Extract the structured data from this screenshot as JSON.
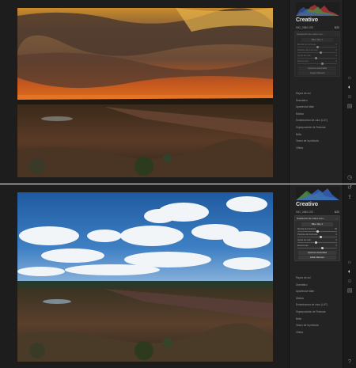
{
  "screens": [
    {
      "module_title": "Creativo",
      "filename": "IMG_0586.CR2",
      "count": "8/20",
      "module_header": "Sustitución de cielos con...",
      "preset": "Blue Sky 1",
      "sliders": [
        {
          "label": "Mezcla de horizonte",
          "value": "0",
          "level": 0.5
        },
        {
          "label": "Posición del horizonte",
          "value": "0",
          "level": 0.55
        },
        {
          "label": "Ajuste de cielo",
          "value": "0",
          "level": 0.45
        },
        {
          "label": "Escena roja",
          "value": "0",
          "level": 0.6
        }
      ],
      "buttons": [
        "Opciones avanzadas",
        "Cargar Máscara"
      ],
      "sections": [
        "Rayos de sol",
        "Dramático",
        "Apariencia Mate",
        "Místico",
        "Embelecedor de color (LUT)",
        "Superposición de Texturas",
        "Brillo",
        "Grano de la película",
        "Viñeta"
      ]
    },
    {
      "module_title": "Creativo",
      "filename": "IMG_0586.CR2",
      "count": "8/20",
      "module_header": "Sustitución de cielos com...",
      "preset": "Blue Sky 1",
      "sliders": [
        {
          "label": "Mezcla de horizonte",
          "value": "30",
          "level": 0.5
        },
        {
          "label": "Posición del horizonte",
          "value": "0",
          "level": 0.55
        },
        {
          "label": "Ajuste de cielo",
          "value": "0",
          "level": 0.45
        },
        {
          "label": "Escena roja",
          "value": "0",
          "level": 0.6
        }
      ],
      "buttons": [
        "Opciones avanzadas",
        "Editar Máscara"
      ],
      "sections": [
        "Rayos de sol",
        "Dramático",
        "Apariencia Mate",
        "Místico",
        "Embelecedor de color (LUT)",
        "Superposición de Texturas",
        "Brillo",
        "Grano de la película",
        "Viñeta"
      ]
    }
  ],
  "icons": [
    "sun-icon",
    "palette-icon",
    "face-icon",
    "layers-icon",
    "clock-icon",
    "history-icon",
    "export-icon",
    "help-icon"
  ],
  "colors": {
    "panel": "#232323",
    "viewer": "#1d1d1d",
    "sunset_orange": "#e06a1e",
    "sky_blue": "#2f6fb0"
  }
}
